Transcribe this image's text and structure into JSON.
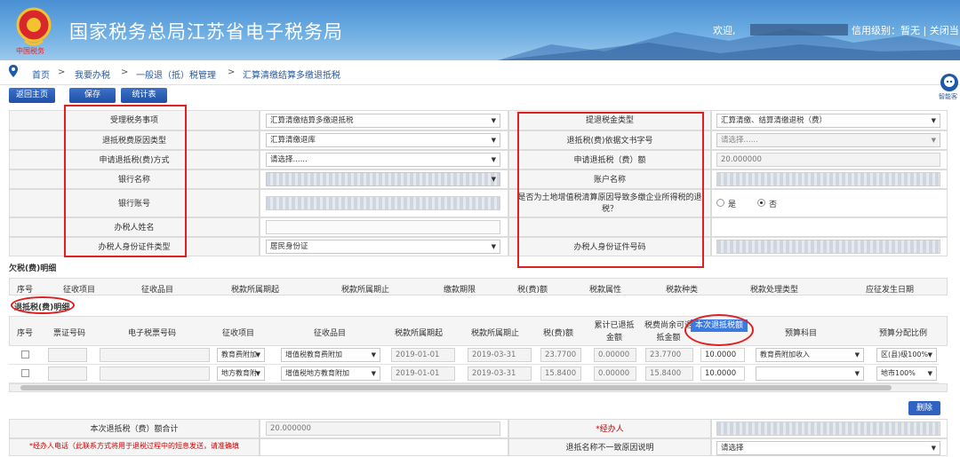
{
  "header": {
    "site_title": "国家税务总局江苏省电子税务局",
    "welcome": "欢迎,",
    "credit": "信用级别：暂无 | 关闭当"
  },
  "breadcrumb": {
    "home": "首页",
    "sep1": ">",
    "my_tax": "我要办税",
    "sep2": ">",
    "general": "一般退（抵）税管理",
    "sep3": ">",
    "current": "汇算清缴结算多缴退抵税"
  },
  "toolbar": {
    "back": "返回主页",
    "save": "保存",
    "stats": "统计表"
  },
  "assistant": {
    "label": "智能客"
  },
  "form": {
    "left": [
      {
        "label": "受理税务事项",
        "value": "汇算清缴结算多缴退抵税",
        "type": "select"
      },
      {
        "label": "退抵税费原因类型",
        "value": "汇算清缴退库",
        "type": "select"
      },
      {
        "label": "申请退抵税(费)方式",
        "value": "请选择......",
        "type": "select"
      },
      {
        "label": "银行名称",
        "value": "",
        "type": "select"
      },
      {
        "label": "银行账号",
        "value": "",
        "type": "input"
      },
      {
        "label": "办税人姓名",
        "value": "",
        "type": "input"
      },
      {
        "label": "办税人身份证件类型",
        "value": "居民身份证",
        "type": "select"
      }
    ],
    "right": [
      {
        "label": "提退税金类型",
        "value": "汇算清缴、结算清缴退税（费）",
        "type": "select"
      },
      {
        "label": "退抵税(费)依据文书字号",
        "value": "请选择......",
        "type": "select"
      },
      {
        "label": "申请退抵税（费）额",
        "value": "20.000000",
        "type": "input"
      },
      {
        "label": "账户名称",
        "value": "",
        "type": "input"
      },
      {
        "label": "是否为土地增值税清算原因导致多缴企业所得税的退税？",
        "value": "",
        "type": "radio"
      },
      {
        "label": "办税人身份证件号码",
        "value": "",
        "type": "input"
      }
    ],
    "radio_yes": "是",
    "radio_no": "否"
  },
  "arrears": {
    "title": "欠税(费)明细",
    "headers": [
      "序号",
      "征收项目",
      "征收品目",
      "税款所属期起",
      "税款所属期止",
      "缴款期限",
      "税(费)额",
      "税款属性",
      "税款种类",
      "税款处理类型",
      "应征发生日期"
    ]
  },
  "refund": {
    "title": "退抵税(费)明细",
    "headers": [
      "序号",
      "票证号码",
      "电子税票号码",
      "征收项目",
      "征收品目",
      "税款所属期起",
      "税款所属期止",
      "税(费)额",
      "累计已退抵金额",
      "税费尚余可退抵金额",
      "本次退抵税额",
      "预算科目",
      "预算分配比例"
    ],
    "rows": [
      {
        "item": "教育费附加",
        "sub": "增值税教育费附加",
        "start": "2019-01-01",
        "end": "2019-03-31",
        "amount": "23.7700",
        "refunded": "0.00000",
        "remain": "23.7700",
        "this": "10.0000",
        "budget": "教育费附加收入",
        "ratio": "区(县)级100%"
      },
      {
        "item": "地方教育附",
        "sub": "增值税地方教育附加",
        "start": "2019-01-01",
        "end": "2019-03-31",
        "amount": "15.8400",
        "refunded": "0.00000",
        "remain": "15.8400",
        "this": "10.0000",
        "budget": "",
        "ratio": "地市100%"
      }
    ]
  },
  "delete_label": "删除",
  "footer": {
    "total_label": "本次退抵税（费）额合计",
    "total_value": "20.000000",
    "agent_label": "*经办人",
    "phone_label": "*经办人电话（此联系方式将用于退税过程中的短息发送，请准确填",
    "mismatch_label": "退抵名称不一致原因说明",
    "mismatch_value": "请选择"
  },
  "colors": {
    "banner": "#4a8fd3",
    "button": "#2e63c2",
    "annotation": "#e02020",
    "link": "#2a5a9a"
  }
}
